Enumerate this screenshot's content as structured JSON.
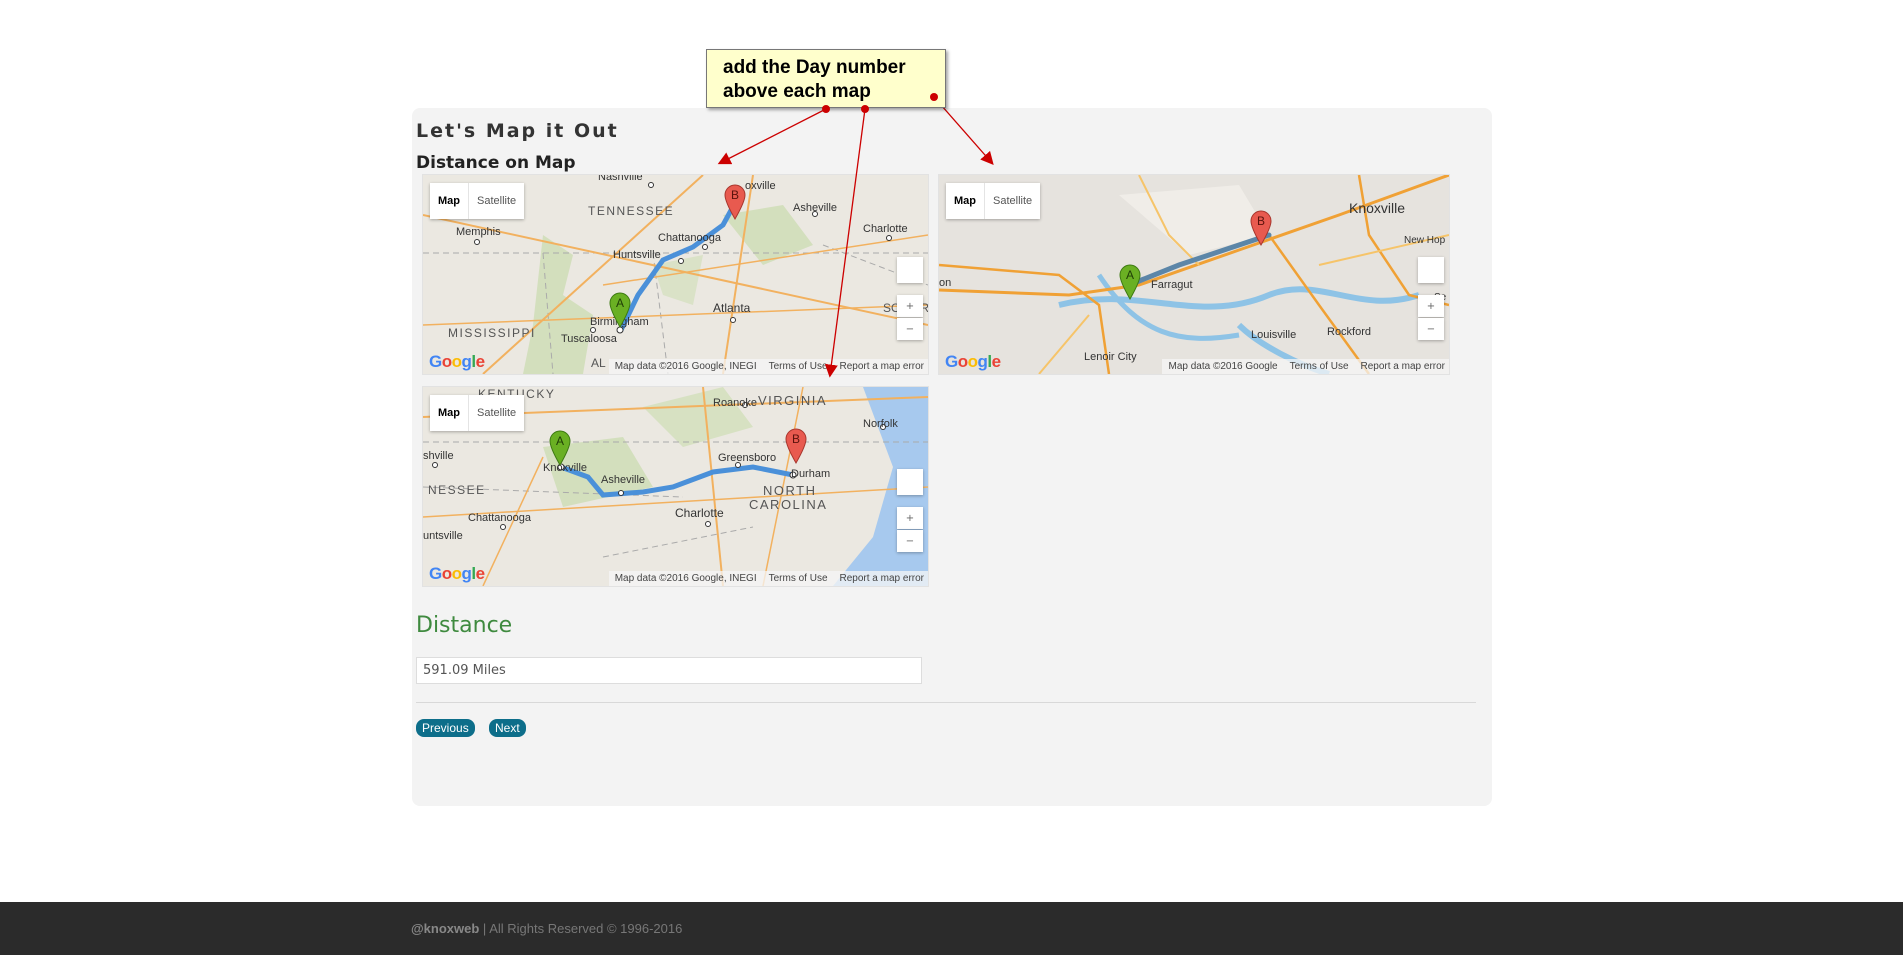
{
  "annotation": {
    "text_line1": "add the Day number",
    "text_line2": "above each map"
  },
  "section": {
    "title": "Let's Map it Out",
    "subtitle": "Distance on Map"
  },
  "maps": [
    {
      "type_map": "Map",
      "type_satellite": "Satellite",
      "attribution": "Map data ©2016 Google, INEGI",
      "terms": "Terms of Use",
      "report": "Report a map error",
      "labels": {
        "l1": "Nashville",
        "l2": "TENNESSEE",
        "l3": "Memphis",
        "l4": "Huntsville",
        "l5": "Chattanooga",
        "l6": "Asheville",
        "l7": "Charlotte",
        "l8": "MISSISSIPPI",
        "l9": "Tuscaloosa",
        "l10": "Birmingham",
        "l11": "Atlanta",
        "l12": "SO CAR",
        "l13": "oxville",
        "l14": "AL"
      },
      "marker_a": "A",
      "marker_b": "B"
    },
    {
      "type_map": "Map",
      "type_satellite": "Satellite",
      "attribution": "Map data ©2016 Google",
      "terms": "Terms of Use",
      "report": "Report a map error",
      "labels": {
        "l1": "Knoxville",
        "l2": "Farragut",
        "l3": "Louisville",
        "l4": "Rockford",
        "l5": "Lenoir City",
        "l6": "New Hop",
        "l7": "on",
        "l8": "Se"
      },
      "marker_a": "A",
      "marker_b": "B"
    },
    {
      "type_map": "Map",
      "type_satellite": "Satellite",
      "attribution": "Map data ©2016 Google, INEGI",
      "terms": "Terms of Use",
      "report": "Report a map error",
      "labels": {
        "l1": "KENTUCKY",
        "l2": "VIRGINIA",
        "l3": "Roanoke",
        "l4": "Norfolk",
        "l5": "shville",
        "l6": "Knoxville",
        "l7": "Greensboro",
        "l8": "Durham",
        "l9": "NESSEE",
        "l10": "Asheville",
        "l11": "NORTH",
        "l12": "CAROLINA",
        "l13": "Chattanooga",
        "l14": "Charlotte",
        "l15": "untsville"
      },
      "marker_a": "A",
      "marker_b": "B"
    }
  ],
  "google_logo": {
    "c1": "G",
    "c2": "o",
    "c3": "o",
    "c4": "g",
    "c5": "l",
    "c6": "e"
  },
  "distance": {
    "heading": "Distance",
    "value": "591.09 Miles"
  },
  "buttons": {
    "previous": "Previous",
    "next": "Next"
  },
  "footer": {
    "handle": "@knoxweb",
    "rights": " | All Rights Reserved © 1996-2016"
  },
  "colors": {
    "route": "#4a90d9",
    "marker_a": "#6ab023",
    "marker_b": "#e85a4f",
    "heading_green": "#3f8a3f",
    "button": "#0d6e8a",
    "arrow": "#cc0000"
  }
}
